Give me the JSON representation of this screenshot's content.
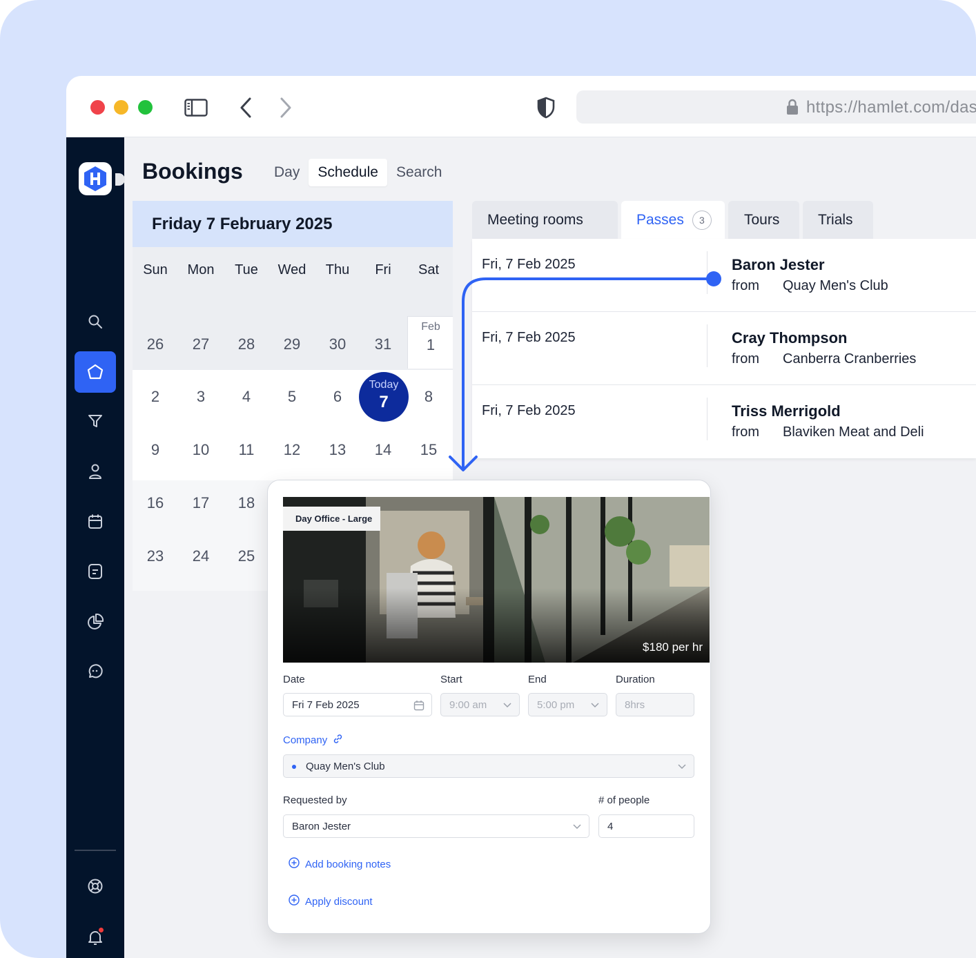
{
  "browser": {
    "url": "https://hamlet.com/das",
    "traffic_lights": [
      "close",
      "minimize",
      "maximize"
    ]
  },
  "sidebar": {
    "items": [
      {
        "name": "search-icon"
      },
      {
        "name": "home-icon",
        "active": true
      },
      {
        "name": "filter-icon"
      },
      {
        "name": "user-icon"
      },
      {
        "name": "calendar-icon"
      },
      {
        "name": "document-icon"
      },
      {
        "name": "pie-chart-icon"
      },
      {
        "name": "chat-icon"
      },
      {
        "name": "help-icon"
      },
      {
        "name": "bell-icon"
      }
    ],
    "accent_color": "#2f63f4"
  },
  "header": {
    "title": "Bookings",
    "tabs": [
      {
        "label": "Day"
      },
      {
        "label": "Schedule",
        "active": true
      },
      {
        "label": "Search"
      }
    ]
  },
  "calendar": {
    "selected_date": "Friday 7 February 2025",
    "days_of_week": [
      "Sun",
      "Mon",
      "Tue",
      "Wed",
      "Thu",
      "Fri",
      "Sat"
    ],
    "weeks": [
      [
        "26",
        "27",
        "28",
        "29",
        "30",
        "31",
        "1"
      ],
      [
        "2",
        "3",
        "4",
        "5",
        "6",
        "7",
        "8"
      ],
      [
        "9",
        "10",
        "11",
        "12",
        "13",
        "14",
        "15"
      ],
      [
        "16",
        "17",
        "18"
      ],
      [
        "23",
        "24",
        "25"
      ]
    ],
    "month_marker": "Feb",
    "today_label": "Today",
    "today_number": "7",
    "today_color": "#0d2b9c"
  },
  "right_tabs": [
    {
      "label": "Meeting rooms"
    },
    {
      "label": "Passes",
      "badge": "3",
      "active": true
    },
    {
      "label": "Tours"
    },
    {
      "label": "Trials"
    }
  ],
  "passes": [
    {
      "date": "Fri, 7 Feb 2025",
      "name": "Baron Jester",
      "from_label": "from",
      "company": "Quay Men's Club"
    },
    {
      "date": "Fri, 7 Feb 2025",
      "name": "Cray Thompson",
      "from_label": "from",
      "company": "Canberra Cranberries"
    },
    {
      "date": "Fri, 7 Feb 2025",
      "name": "Triss Merrigold",
      "from_label": "from",
      "company": "Blaviken Meat and Deli"
    }
  ],
  "booking_modal": {
    "room_tag": "Day Office - Large",
    "price": "$180 per hr",
    "labels": {
      "date": "Date",
      "start": "Start",
      "end": "End",
      "duration": "Duration",
      "company": "Company",
      "requested_by": "Requested by",
      "people": "# of people"
    },
    "values": {
      "date": "Fri 7 Feb 2025",
      "start": "9:00 am",
      "end": "5:00 pm",
      "duration": "8hrs",
      "company": "Quay Men's Club",
      "requested_by": "Baron Jester",
      "people": "4"
    },
    "add_notes": "Add booking notes",
    "apply_discount": "Apply discount"
  }
}
